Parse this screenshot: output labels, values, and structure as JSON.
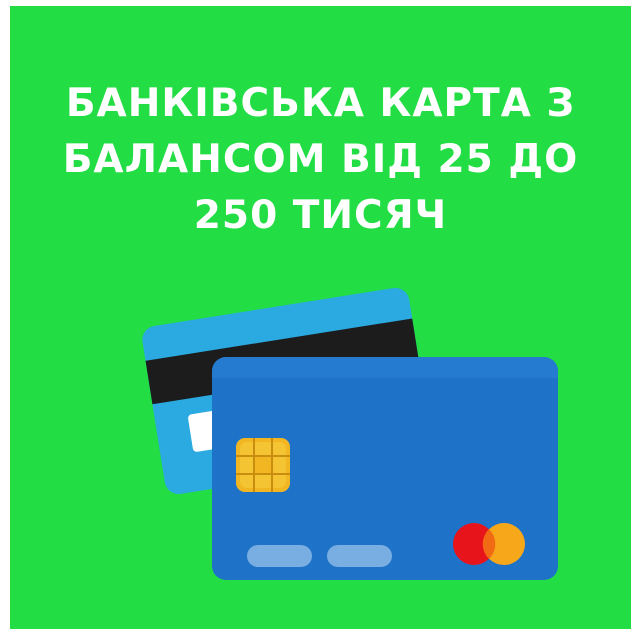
{
  "headline": {
    "line1": "БАНКІВСЬКА КАРТА З",
    "line2": "БАЛАНСОМ ВІД 25 ДО",
    "line3": "250 ТИСЯЧ"
  },
  "colors": {
    "background": "#22dd44",
    "text": "#ffffff",
    "back_card": "#2aaae0",
    "front_card": "#1e72c8",
    "magnetic_stripe": "#1c1c1c",
    "chip": "#f2b622",
    "mastercard_red": "#e8141c",
    "mastercard_yellow": "#f7a81a"
  },
  "icons": [
    "credit-card-back",
    "credit-card-front",
    "chip-icon",
    "mastercard-logo-icon"
  ]
}
